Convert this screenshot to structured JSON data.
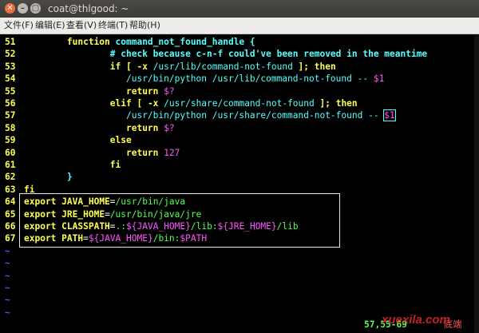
{
  "window": {
    "title": "coat@thlgood: ~",
    "close_glyph": "✕",
    "min_glyph": "–",
    "max_glyph": "▢"
  },
  "menu": [
    "文件(F)",
    "编辑(E)",
    "查看(V)",
    "终端(T)",
    "帮助(H)"
  ],
  "lines": [
    {
      "n": "51",
      "segs": [
        {
          "t": "        ",
          "c": "pl"
        },
        {
          "t": "function",
          "c": "kw"
        },
        {
          "t": " command_not_found_handle {",
          "c": "fn"
        }
      ]
    },
    {
      "n": "52",
      "segs": [
        {
          "t": "                ",
          "c": "pl"
        },
        {
          "t": "# check because c-n-f could've been removed in the meantime",
          "c": "cm"
        }
      ]
    },
    {
      "n": "53",
      "segs": [
        {
          "t": "                ",
          "c": "pl"
        },
        {
          "t": "if",
          "c": "kw"
        },
        {
          "t": " [ -x ",
          "c": "kw"
        },
        {
          "t": "/usr/lib/command-not-found",
          "c": "str"
        },
        {
          "t": " ]; ",
          "c": "kw"
        },
        {
          "t": "then",
          "c": "kw"
        }
      ]
    },
    {
      "n": "54",
      "segs": [
        {
          "t": "                   ",
          "c": "pl"
        },
        {
          "t": "/usr/bin/python /usr/lib/command-not-found -- ",
          "c": "str"
        },
        {
          "t": "$1",
          "c": "var"
        }
      ]
    },
    {
      "n": "55",
      "segs": [
        {
          "t": "                   ",
          "c": "pl"
        },
        {
          "t": "return",
          "c": "kw"
        },
        {
          "t": " ",
          "c": "pl"
        },
        {
          "t": "$?",
          "c": "var"
        }
      ]
    },
    {
      "n": "56",
      "segs": [
        {
          "t": "                ",
          "c": "pl"
        },
        {
          "t": "elif",
          "c": "kw"
        },
        {
          "t": " [ -x ",
          "c": "kw"
        },
        {
          "t": "/usr/share/command-not-found",
          "c": "str"
        },
        {
          "t": " ]; ",
          "c": "kw"
        },
        {
          "t": "then",
          "c": "kw"
        }
      ]
    },
    {
      "n": "57",
      "segs": [
        {
          "t": "                   ",
          "c": "pl"
        },
        {
          "t": "/usr/bin/python /usr/share/command-not-found -- ",
          "c": "str"
        },
        {
          "t": "$1",
          "c": "var curs"
        }
      ]
    },
    {
      "n": "58",
      "segs": [
        {
          "t": "                   ",
          "c": "pl"
        },
        {
          "t": "return",
          "c": "kw"
        },
        {
          "t": " ",
          "c": "pl"
        },
        {
          "t": "$?",
          "c": "var"
        }
      ]
    },
    {
      "n": "59",
      "segs": [
        {
          "t": "                ",
          "c": "pl"
        },
        {
          "t": "else",
          "c": "kw"
        }
      ]
    },
    {
      "n": "60",
      "segs": [
        {
          "t": "                   ",
          "c": "pl"
        },
        {
          "t": "return",
          "c": "kw"
        },
        {
          "t": " ",
          "c": "pl"
        },
        {
          "t": "127",
          "c": "num"
        }
      ]
    },
    {
      "n": "61",
      "segs": [
        {
          "t": "                ",
          "c": "pl"
        },
        {
          "t": "fi",
          "c": "kw"
        }
      ]
    },
    {
      "n": "62",
      "segs": [
        {
          "t": "        ",
          "c": "pl"
        },
        {
          "t": "}",
          "c": "fn"
        }
      ]
    },
    {
      "n": "63",
      "segs": [
        {
          "t": "fi",
          "c": "kw"
        }
      ]
    },
    {
      "n": "64",
      "segs": [
        {
          "t": "export",
          "c": "kw"
        },
        {
          "t": " ",
          "c": "pl"
        },
        {
          "t": "JAVA_HOME",
          "c": "kw"
        },
        {
          "t": "=",
          "c": "pl"
        },
        {
          "t": "/usr/bin/java",
          "c": "gr"
        }
      ]
    },
    {
      "n": "65",
      "segs": [
        {
          "t": "export",
          "c": "kw"
        },
        {
          "t": " ",
          "c": "pl"
        },
        {
          "t": "JRE_HOME",
          "c": "kw"
        },
        {
          "t": "=",
          "c": "pl"
        },
        {
          "t": "/usr/bin/java/jre",
          "c": "gr"
        }
      ]
    },
    {
      "n": "66",
      "segs": [
        {
          "t": "export",
          "c": "kw"
        },
        {
          "t": " ",
          "c": "pl"
        },
        {
          "t": "CLASSPATH",
          "c": "kw"
        },
        {
          "t": "=",
          "c": "pl"
        },
        {
          "t": ".:",
          "c": "gr"
        },
        {
          "t": "${JAVA_HOME}",
          "c": "var"
        },
        {
          "t": "/lib:",
          "c": "gr"
        },
        {
          "t": "${JRE_HOME}",
          "c": "var"
        },
        {
          "t": "/lib",
          "c": "gr"
        }
      ]
    },
    {
      "n": "67",
      "segs": [
        {
          "t": "export",
          "c": "kw"
        },
        {
          "t": " ",
          "c": "pl"
        },
        {
          "t": "PATH",
          "c": "kw"
        },
        {
          "t": "=",
          "c": "pl"
        },
        {
          "t": "${JAVA_HOME}",
          "c": "var"
        },
        {
          "t": "/bin:",
          "c": "gr"
        },
        {
          "t": "$PATH",
          "c": "var"
        }
      ]
    }
  ],
  "tildes": [
    "~",
    "~",
    "~",
    "~",
    "~",
    "~"
  ],
  "status": {
    "position": "57,55-69",
    "scroll": "底端"
  },
  "watermark": "xuexila.com"
}
